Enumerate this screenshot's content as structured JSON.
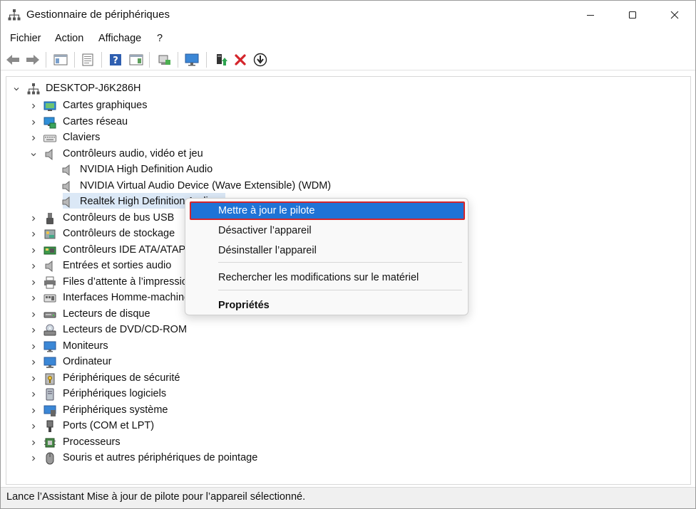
{
  "window": {
    "title": "Gestionnaire de périphériques"
  },
  "menu": [
    "Fichier",
    "Action",
    "Affichage",
    "?"
  ],
  "toolbar": {
    "buttons": [
      "back-icon",
      "forward-icon",
      "console-tree-icon",
      "properties-icon",
      "help-icon",
      "action-pane-icon",
      "scan-hardware-icon",
      "monitor-icon",
      "update-driver-icon",
      "uninstall-icon",
      "download-icon"
    ]
  },
  "tree": {
    "root": "DESKTOP-J6K286H",
    "categories": [
      {
        "label": "Cartes graphiques",
        "icon": "display-adapter-icon"
      },
      {
        "label": "Cartes réseau",
        "icon": "network-adapter-icon"
      },
      {
        "label": "Claviers",
        "icon": "keyboard-icon"
      },
      {
        "label": "Contrôleurs audio, vidéo et jeu",
        "icon": "speaker-icon",
        "expanded": true,
        "children": [
          "NVIDIA High Definition Audio",
          "NVIDIA Virtual Audio Device (Wave Extensible) (WDM)",
          "Realtek High Definition Audio"
        ]
      },
      {
        "label": "Contrôleurs de bus USB",
        "icon": "usb-icon"
      },
      {
        "label": "Contrôleurs de stockage",
        "icon": "storage-controller-icon"
      },
      {
        "label": "Contrôleurs IDE ATA/ATAPI",
        "icon": "ide-controller-icon"
      },
      {
        "label": "Entrées et sorties audio",
        "icon": "audio-io-icon"
      },
      {
        "label": "Files d’attente à l’impression",
        "icon": "printer-icon"
      },
      {
        "label": "Interfaces Homme-machine",
        "icon": "hid-icon"
      },
      {
        "label": "Lecteurs de disque",
        "icon": "disk-drive-icon"
      },
      {
        "label": "Lecteurs de DVD/CD-ROM",
        "icon": "dvd-drive-icon"
      },
      {
        "label": "Moniteurs",
        "icon": "monitor-icon"
      },
      {
        "label": "Ordinateur",
        "icon": "computer-icon"
      },
      {
        "label": "Périphériques de sécurité",
        "icon": "security-device-icon"
      },
      {
        "label": "Périphériques logiciels",
        "icon": "software-device-icon"
      },
      {
        "label": "Périphériques système",
        "icon": "system-device-icon"
      },
      {
        "label": "Ports (COM et LPT)",
        "icon": "port-icon"
      },
      {
        "label": "Processeurs",
        "icon": "processor-icon"
      },
      {
        "label": "Souris et autres périphériques de pointage",
        "icon": "mouse-icon"
      }
    ]
  },
  "context_menu": {
    "items": [
      "Mettre à jour le pilote",
      "Désactiver l’appareil",
      "Désinstaller l’appareil",
      "Rechercher les modifications sur le matériel",
      "Propriétés"
    ]
  },
  "status": "Lance l’Assistant Mise à jour de pilote pour l’appareil sélectionné.",
  "colors": {
    "highlight": "#1f73d6",
    "highlight_border": "#d4252b",
    "selection": "#dbe8f6"
  }
}
